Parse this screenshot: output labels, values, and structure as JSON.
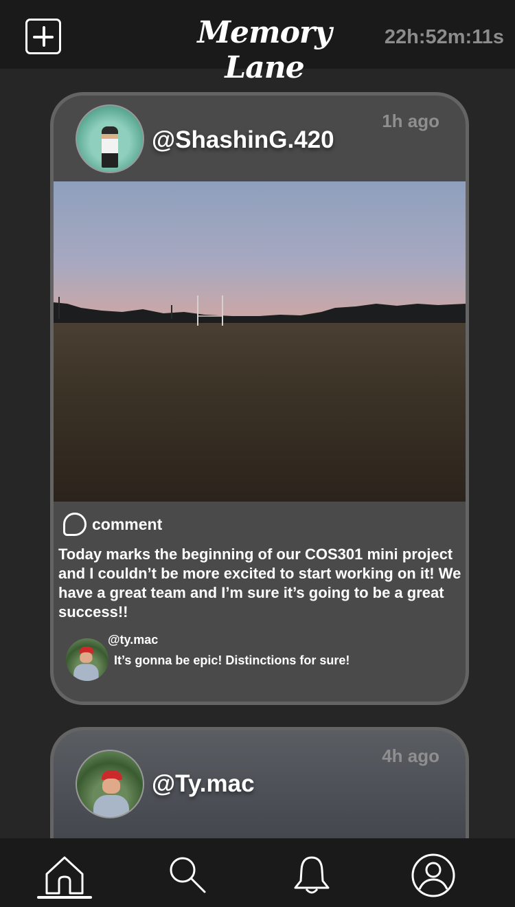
{
  "header": {
    "add_icon": "plus-square-icon",
    "title": "Memory Lane",
    "timer": "22h:52m:11s"
  },
  "posts": [
    {
      "username": "@ShashinG.420",
      "time_ago": "1h ago",
      "comment_label": "comment",
      "caption": "Today marks the beginning of our COS301 mini project and I couldn’t be more excited to start working on it! We have a great team and I’m sure it’s going to be a great success!!",
      "comments": [
        {
          "user": "@ty.mac",
          "text": "It’s gonna be epic! Distinctions for sure!"
        }
      ]
    },
    {
      "username": "@Ty.mac",
      "time_ago": "4h ago"
    }
  ],
  "nav": {
    "items": [
      "home-icon",
      "search-icon",
      "bell-icon",
      "profile-icon"
    ],
    "active": "home"
  },
  "colors": {
    "background": "#262626",
    "bar": "#1a1a1a",
    "card": "#4a4a4a",
    "card_border": "#646464",
    "muted_text": "#8c8c8c"
  }
}
